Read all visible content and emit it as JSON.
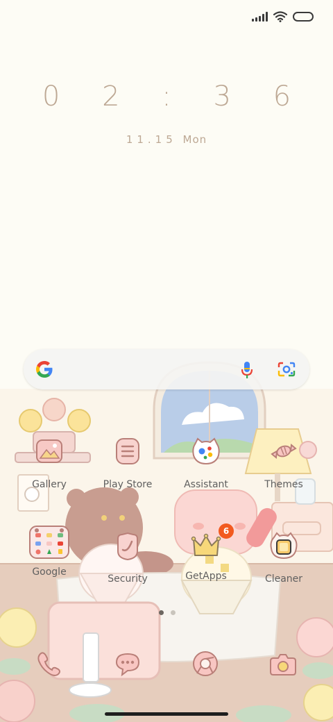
{
  "status_bar": {
    "signal_icon": "signal-bars-icon",
    "wifi_icon": "wifi-icon",
    "battery_icon": "battery-icon"
  },
  "clock": {
    "time": "0 2 : 3 6"
  },
  "date": {
    "day": "11.15",
    "weekday": "Mon"
  },
  "search_bar": {
    "logo": "google-g-icon",
    "voice_icon": "microphone-icon",
    "lens_icon": "google-lens-icon"
  },
  "apps_row1": [
    {
      "label": "Gallery",
      "icon": "gallery-icon"
    },
    {
      "label": "Play Store",
      "icon": "play-store-icon"
    },
    {
      "label": "Assistant",
      "icon": "assistant-icon"
    },
    {
      "label": "Themes",
      "icon": "themes-candy-icon"
    }
  ],
  "apps_row2": [
    {
      "label": "Google",
      "icon": "google-folder-icon"
    },
    {
      "label": "Security",
      "icon": "security-icon"
    },
    {
      "label": "GetApps",
      "icon": "crown-icon",
      "badge": "6"
    },
    {
      "label": "Cleaner",
      "icon": "cleaner-icon"
    }
  ],
  "dock": [
    "phone-icon",
    "messages-icon",
    "chrome-icon",
    "camera-icon"
  ],
  "pager": {
    "pages": 2,
    "current": 1
  },
  "colors": {
    "background": "#fdfcf5",
    "clock_text": "#bda894",
    "badge": "#f25a1f",
    "icon_outline": "#b97f78"
  }
}
